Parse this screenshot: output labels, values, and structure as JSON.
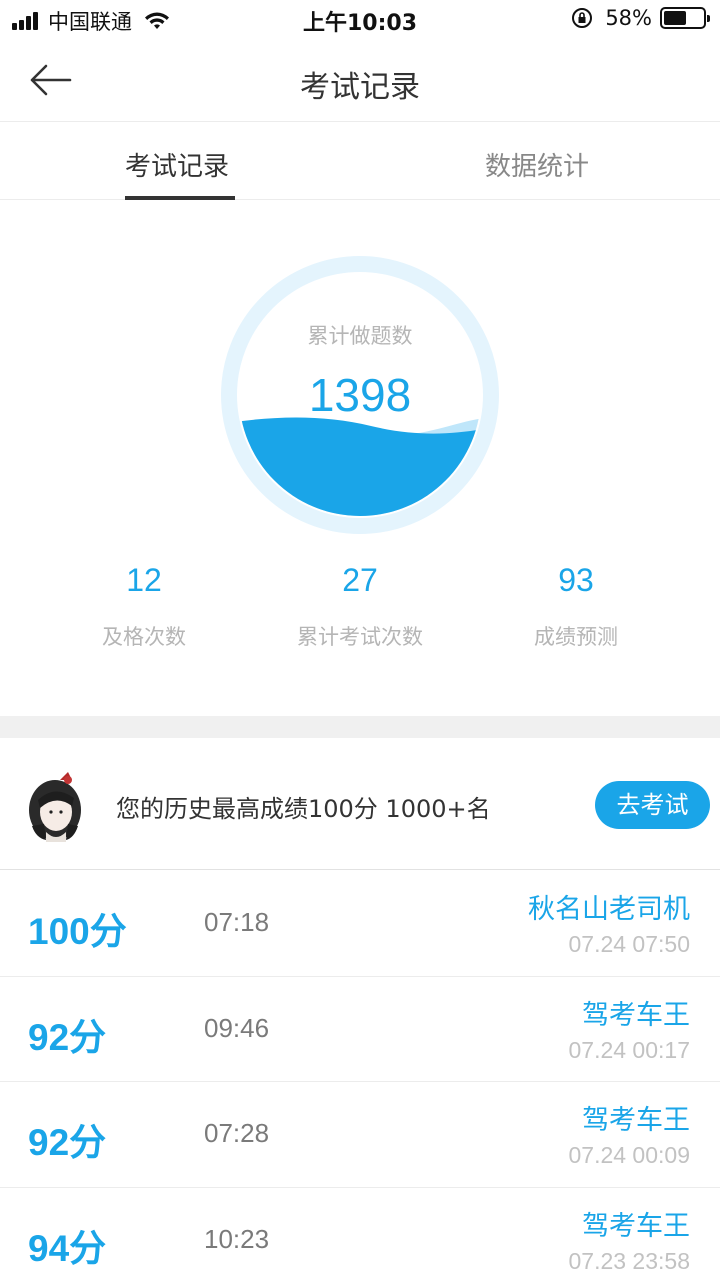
{
  "status_bar": {
    "carrier": "中国联通",
    "time": "上午10:03",
    "battery_percent": "58%",
    "battery_level": 0.58
  },
  "nav": {
    "title": "考试记录",
    "back_icon": "back-arrow-icon"
  },
  "tabs": [
    {
      "label": "考试记录",
      "active": true
    },
    {
      "label": "数据统计",
      "active": false
    }
  ],
  "summary": {
    "circle_label": "累计做题数",
    "circle_value": "1398",
    "stats": [
      {
        "value": "12",
        "label": "及格次数"
      },
      {
        "value": "27",
        "label": "累计考试次数"
      },
      {
        "value": "93",
        "label": "成绩预测"
      }
    ]
  },
  "best": {
    "text": "您的历史最高成绩100分  1000+名",
    "button_label": "去考试"
  },
  "records": [
    {
      "score": "100分",
      "duration": "07:18",
      "title": "秋名山老司机",
      "date": "07.24 07:50"
    },
    {
      "score": "92分",
      "duration": "09:46",
      "title": "驾考车王",
      "date": "07.24 00:17"
    },
    {
      "score": "92分",
      "duration": "07:28",
      "title": "驾考车王",
      "date": "07.24 00:09"
    },
    {
      "score": "94分",
      "duration": "10:23",
      "title": "驾考车王",
      "date": "07.23 23:58"
    }
  ],
  "colors": {
    "accent": "#1aa5e8",
    "wave_light": "#bfe6fa",
    "ring": "#e4f4fd"
  }
}
